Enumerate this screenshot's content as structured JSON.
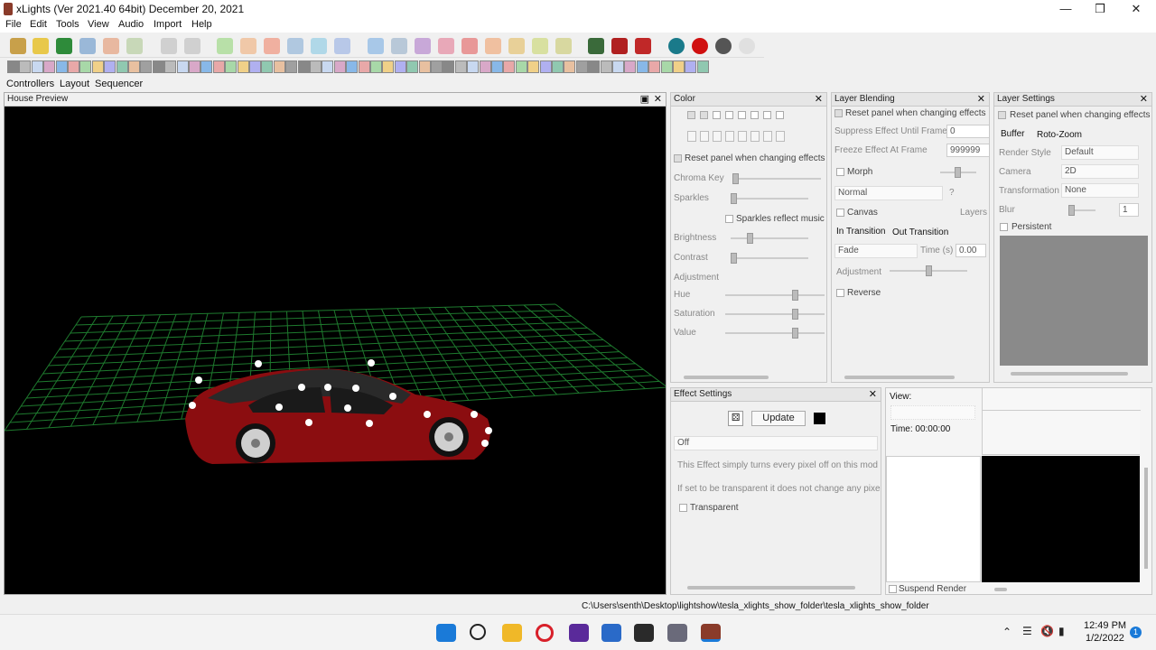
{
  "window": {
    "title": "xLights (Ver 2021.40 64bit) December 20, 2021",
    "min": "—",
    "max": "❒",
    "close": "✕"
  },
  "menu": [
    "File",
    "Edit",
    "Tools",
    "View",
    "Audio",
    "Import",
    "Help"
  ],
  "tabs": [
    "Controllers",
    "Layout",
    "Sequencer"
  ],
  "house_preview": {
    "title": "House Preview",
    "float": "▣",
    "close": "✕"
  },
  "color": {
    "title": "Color",
    "close": "✕",
    "reset": "Reset panel when changing effects",
    "chroma_key": "Chroma Key",
    "sparkles": "Sparkles",
    "sparkles_music": "Sparkles reflect music",
    "brightness": "Brightness",
    "contrast": "Contrast",
    "adjustment": "Adjustment",
    "hue": "Hue",
    "saturation": "Saturation",
    "value": "Value"
  },
  "blending": {
    "title": "Layer Blending",
    "close": "✕",
    "reset": "Reset panel when changing effects",
    "suppress": "Suppress Effect Until Frame",
    "suppress_val": "0",
    "freeze": "Freeze Effect At Frame",
    "freeze_val": "999999",
    "morph": "Morph",
    "mode": "Normal",
    "q": "?",
    "canvas": "Canvas",
    "layers": "Layers ...",
    "in_trans": "In Transition",
    "out_trans": "Out Transition",
    "trans_type": "Fade",
    "time_lbl": "Time (s)",
    "time_val": "0.00",
    "adjustment": "Adjustment",
    "reverse": "Reverse"
  },
  "layer_settings": {
    "title": "Layer Settings",
    "close": "✕",
    "reset": "Reset panel when changing effects",
    "buffer": "Buffer",
    "roto": "Roto-Zoom",
    "render_style": "Render Style",
    "render_val": "Default",
    "camera": "Camera",
    "camera_val": "2D",
    "transformation": "Transformation",
    "transform_val": "None",
    "blur": "Blur",
    "blur_val": "1",
    "persistent": "Persistent"
  },
  "effect_settings": {
    "title": "Effect Settings",
    "close": "✕",
    "update": "Update",
    "effect": "Off",
    "desc1": "This Effect simply turns every pixel off on this mod",
    "desc2": "If set to be transparent it does not change any pixe",
    "transparent": "Transparent"
  },
  "view": {
    "label": "View:",
    "time": "Time: 00:00:00",
    "suspend": "Suspend Render"
  },
  "status_path": "C:\\Users\\senth\\Desktop\\lightshow\\tesla_xlights_show_folder\\tesla_xlights_show_folder",
  "clock": {
    "time": "12:49 PM",
    "date": "1/2/2022"
  },
  "colors": {
    "car": "#8b0d10",
    "grid": "#1e7a2e"
  }
}
